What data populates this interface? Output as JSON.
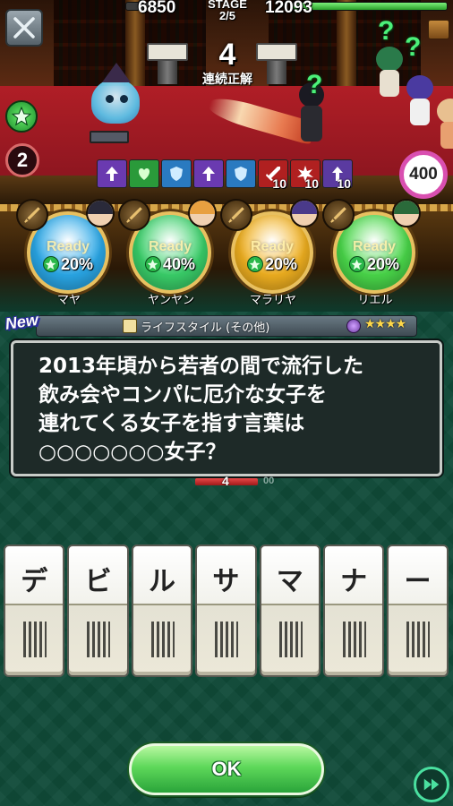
{
  "hud": {
    "player_score": "6850",
    "enemy_score": "12093",
    "stage_label": "STAGE",
    "stage_progress": "2/5",
    "streak_count": "4",
    "streak_label": "連続正解",
    "turns_remaining": "2",
    "enemy_hp_badge": "400",
    "enemy_hp_fraction": 0.7
  },
  "buffs": [
    {
      "icon": "attack-up-icon",
      "color": "#6a3ab0",
      "count": ""
    },
    {
      "icon": "heal-icon",
      "color": "#2a9a3a",
      "count": ""
    },
    {
      "icon": "shield-icon",
      "color": "#2a7ac0",
      "count": ""
    },
    {
      "icon": "attack-up-icon",
      "color": "#6a3ab0",
      "count": ""
    },
    {
      "icon": "shield-icon",
      "color": "#2a7ac0",
      "count": ""
    },
    {
      "icon": "sword-icon",
      "color": "#b02020",
      "count": "10"
    },
    {
      "icon": "burst-icon",
      "color": "#b02020",
      "count": "10"
    },
    {
      "icon": "arrow-up-icon",
      "color": "#5a3aa0",
      "count": "10"
    }
  ],
  "party": [
    {
      "name": "マヤ",
      "ready": "Ready",
      "charge": "20%",
      "orb_color": "#2aa8e8",
      "hair": "#2a2a3a"
    },
    {
      "name": "ヤンヤン",
      "ready": "Ready",
      "charge": "40%",
      "orb_color": "#3ad06a",
      "hair": "#e8a040"
    },
    {
      "name": "マラリヤ",
      "ready": "Ready",
      "charge": "20%",
      "orb_color": "#f0b020",
      "hair": "#4a3a8a"
    },
    {
      "name": "リエル",
      "ready": "Ready",
      "charge": "20%",
      "orb_color": "#4ad84a",
      "hair": "#2a6a3a"
    }
  ],
  "category": {
    "new_badge": "New",
    "label": "ライフスタイル (その他)",
    "stars": "★★★★"
  },
  "question": {
    "lines": [
      "2013年頃から若者の間で流行した",
      "飲み会やコンパに厄介な女子を",
      "連れてくる女子を指す言葉は",
      "○○○○○○○女子？"
    ]
  },
  "timer": {
    "seconds": "4",
    "sub": "00"
  },
  "answer_tiles": [
    "デ",
    "ビ",
    "ル",
    "サ",
    "マ",
    "ナ",
    "ー"
  ],
  "controls": {
    "ok_label": "OK"
  }
}
